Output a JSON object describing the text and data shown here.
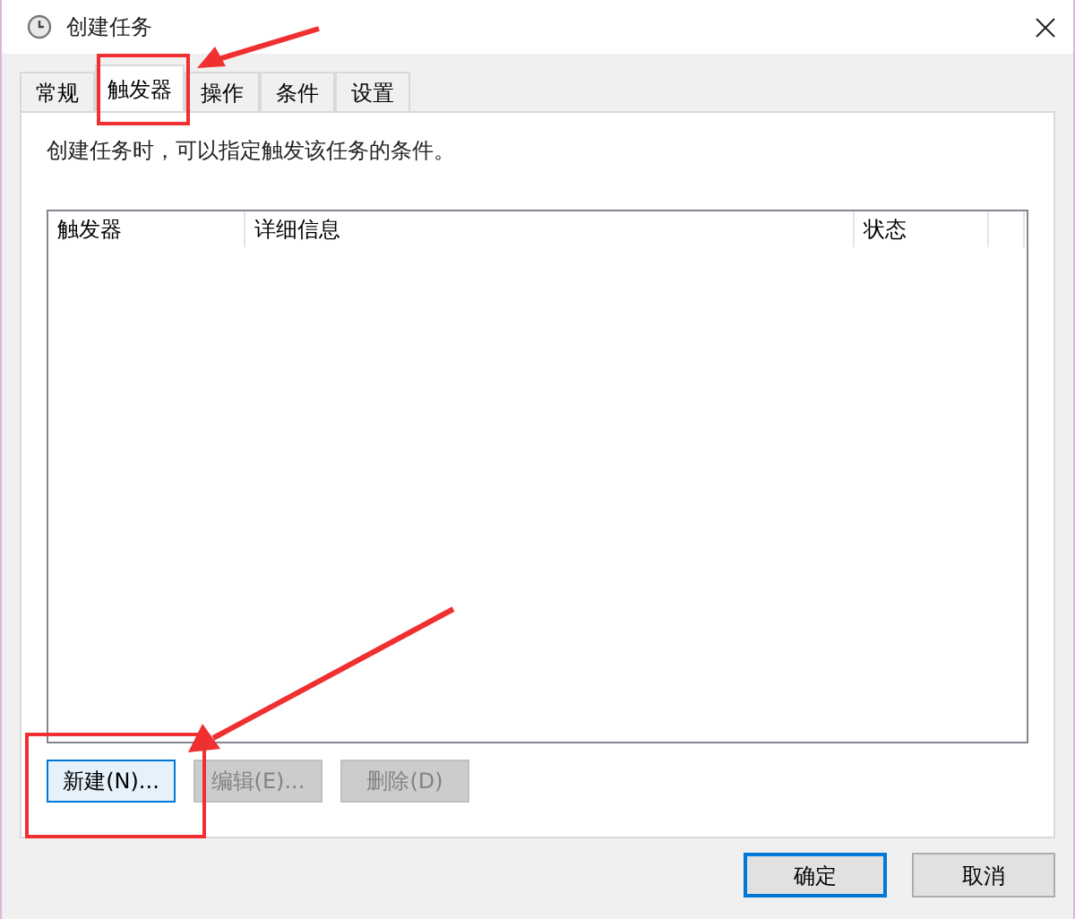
{
  "window": {
    "title": "创建任务"
  },
  "tabs": [
    {
      "label": "常规",
      "selected": false
    },
    {
      "label": "触发器",
      "selected": true
    },
    {
      "label": "操作",
      "selected": false
    },
    {
      "label": "条件",
      "selected": false
    },
    {
      "label": "设置",
      "selected": false
    }
  ],
  "description": "创建任务时，可以指定触发该任务的条件。",
  "table": {
    "columns": [
      "触发器",
      "详细信息",
      "状态"
    ]
  },
  "buttons": [
    {
      "label": "新建(N)...",
      "disabled": false,
      "focused": true
    },
    {
      "label": "编辑(E)...",
      "disabled": true,
      "focused": false
    },
    {
      "label": "删除(D)",
      "disabled": true,
      "focused": false
    }
  ],
  "dialog_buttons": [
    {
      "label": "确定",
      "focused": true
    },
    {
      "label": "取消",
      "focused": false
    }
  ]
}
